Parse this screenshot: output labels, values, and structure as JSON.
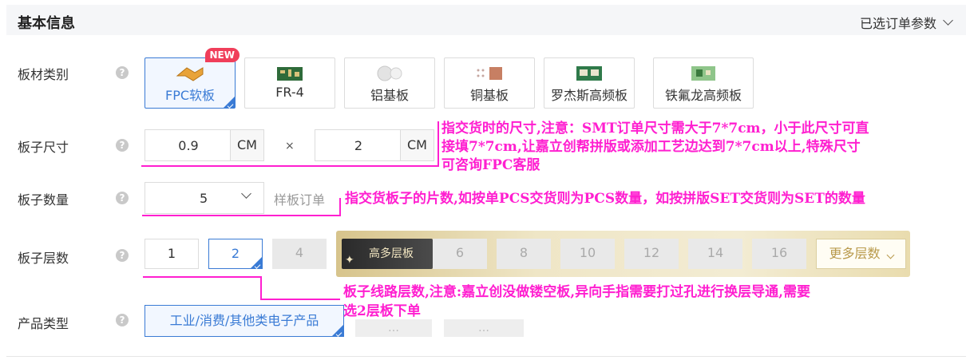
{
  "header": {
    "title": "基本信息",
    "right_label": "已选订单参数"
  },
  "rows": {
    "material": "板材类别",
    "size": "板子尺寸",
    "quantity": "板子数量",
    "layers": "板子层数",
    "product": "产品类型"
  },
  "help_symbol": "?",
  "materials": [
    {
      "label": "FPC软板",
      "badge": "NEW",
      "selected": true
    },
    {
      "label": "FR-4"
    },
    {
      "label": "铝基板"
    },
    {
      "label": "铜基板"
    },
    {
      "label": "罗杰斯高频板"
    },
    {
      "label": "铁氟龙高频板"
    }
  ],
  "size": {
    "width": "0.9",
    "height": "2",
    "unit": "CM",
    "times": "×"
  },
  "quantity": {
    "value": "5",
    "hint": "样板订单"
  },
  "layers": {
    "options": [
      "1",
      "2",
      "4",
      "6",
      "8",
      "10",
      "12",
      "14",
      "16"
    ],
    "selected": "2",
    "many_label": "高多层板",
    "more_label": "更多层数"
  },
  "product": {
    "selected": "工业/消费/其他类电子产品",
    "ghost1": "…",
    "ghost2": "…"
  },
  "annotations": {
    "size_line1": "指交货时的尺寸,注意：SMT订单尺寸需大于7*7cm，小于此尺寸可直",
    "size_line2": "接填7*7cm,让嘉立创帮拼版或添加工艺边达到7*7cm以上,特殊尺寸",
    "size_line3": "可咨询FPC客服",
    "qty": "指交货板子的片数,如按单PCS交货则为PCS数量，如按拼版SET交货则为SET的数量",
    "layers_line1": "板子线路层数,注意:嘉立创没做镂空板,异向手指需要打过孔进行换层导通,需要",
    "layers_line2": "选2层板下单"
  },
  "colors": {
    "accent": "#3a7bd5",
    "annotation": "#ff1fd0",
    "badge": "#f03e5a"
  }
}
